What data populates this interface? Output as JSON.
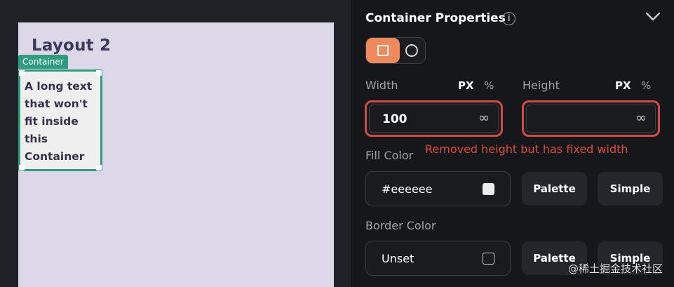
{
  "canvas": {
    "artboard_title": "Layout 2",
    "container_tag": "Container",
    "container_text": "A long text that won't fit inside this Container",
    "container_bg": "#eeeeee",
    "accent": "#2f9c80"
  },
  "panel": {
    "title": "Container Properties",
    "info_icon": "info-icon",
    "collapse_icon": "chevron-down-icon",
    "shape_options": [
      "rectangle",
      "circle"
    ],
    "shape_selected": "rectangle",
    "width": {
      "label": "Width",
      "unit_px": "PX",
      "unit_pct": "%",
      "value": "100",
      "suffix": "∞"
    },
    "height": {
      "label": "Height",
      "unit_px": "PX",
      "unit_pct": "%",
      "value": "",
      "suffix": "∞"
    },
    "annotation": "Removed height but has fixed width",
    "fill_color": {
      "label": "Fill Color",
      "value": "#eeeeee",
      "swatch": "#eeeeee",
      "palette_label": "Palette",
      "simple_label": "Simple"
    },
    "border_color": {
      "label": "Border Color",
      "value": "Unset",
      "palette_label": "Palette",
      "simple_label": "Simple"
    }
  },
  "watermark": "@稀土掘金技术社区",
  "colors": {
    "highlight_red": "#d24a45",
    "toggle_orange": "#ee8a5c"
  }
}
